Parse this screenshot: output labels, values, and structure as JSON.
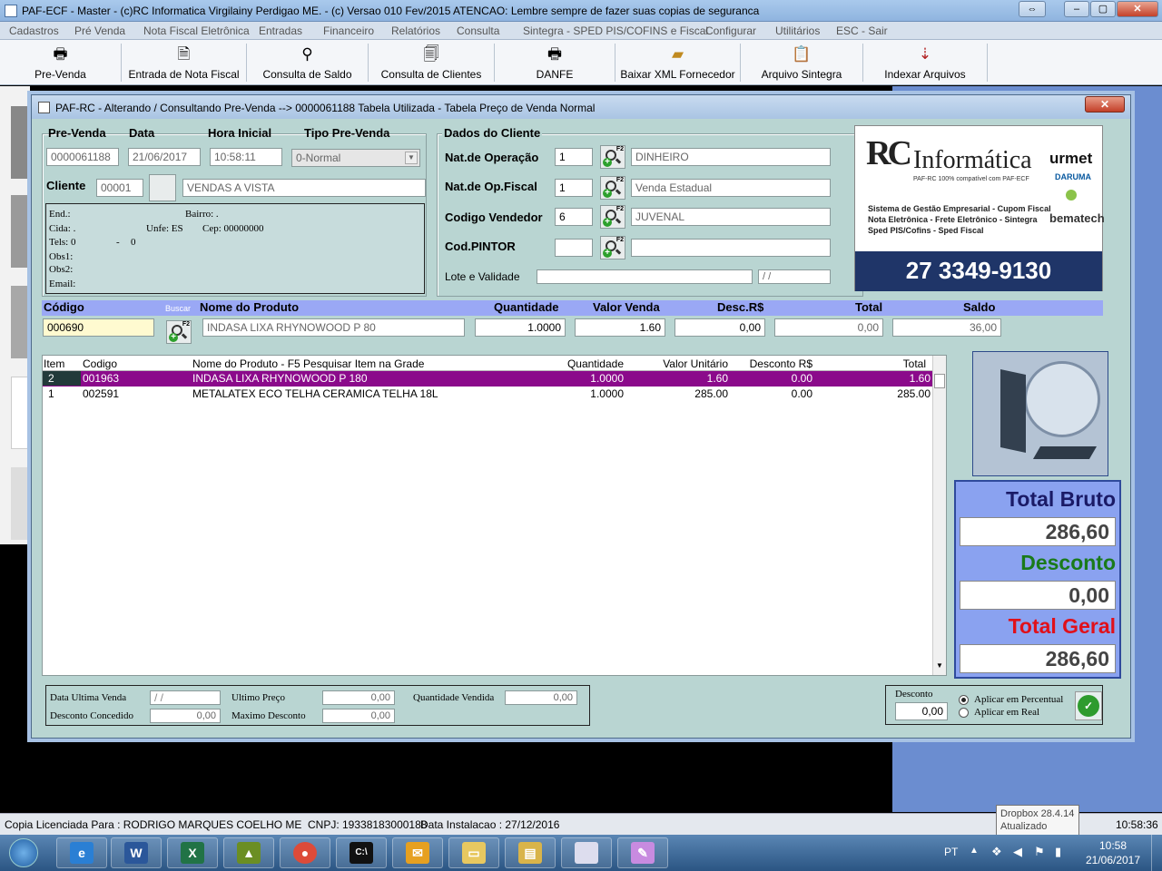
{
  "window": {
    "title": "PAF-ECF - Master - (c)RC Informatica Virgilainy Perdigao ME.  - (c) Versao 010 Fev/2015 ATENCAO: Lembre sempre de fazer suas copias de seguranca"
  },
  "menu": [
    "Cadastros",
    "Pré Venda",
    "Nota Fiscal Eletrônica",
    "Entradas",
    "Financeiro",
    "Relatórios",
    "Consulta",
    "Sintegra - SPED PIS/COFINS e Fiscal",
    "Configurar",
    "Utilitários",
    "ESC - Sair"
  ],
  "toolbar": [
    {
      "label": "Pre-Venda",
      "icon": "printer-icon"
    },
    {
      "label": "Entrada de Nota Fiscal",
      "icon": "document-icon"
    },
    {
      "label": "Consulta de Saldo",
      "icon": "magnifier-icon"
    },
    {
      "label": "Consulta de Clientes",
      "icon": "document-search-icon"
    },
    {
      "label": "DANFE",
      "icon": "printer-icon"
    },
    {
      "label": "Baixar XML Fornecedor",
      "icon": "folder-open-icon"
    },
    {
      "label": "Arquivo Sintegra",
      "icon": "clipboard-icon"
    },
    {
      "label": "Indexar Arquivos",
      "icon": "file-arrow-icon"
    }
  ],
  "dialog": {
    "title": "PAF-RC - Alterando / Consultando Pre-Venda --> 0000061188 Tabela Utilizada - Tabela Preço de Venda Normal",
    "prevenda": {
      "label_prevenda": "Pre-Venda",
      "label_data": "Data",
      "label_hora": "Hora Inicial",
      "label_tipo": "Tipo Pre-Venda",
      "numero": "0000061188",
      "data": "21/06/2017",
      "hora": "10:58:11",
      "tipo": "0-Normal",
      "label_cliente": "Cliente",
      "cliente_codigo": "00001",
      "cliente_nome": "VENDAS A VISTA"
    },
    "endereco": {
      "end": "End.:",
      "bairro": "Bairro: .",
      "cida": "Cida: .",
      "unfe": "Unfe: ES",
      "cep": "Cep: 00000000",
      "tels": "Tels: 0",
      "tels_dash": "-",
      "tels2": "0",
      "obs1": "Obs1:",
      "obs2": "Obs2:",
      "email": "Email:"
    },
    "cliente_dados": {
      "title": "Dados do Cliente",
      "nat_op_label": "Nat.de Operação",
      "nat_op_cod": "1",
      "nat_op_desc": "DINHEIRO",
      "nat_fiscal_label": "Nat.de Op.Fiscal",
      "nat_fiscal_cod": "1",
      "nat_fiscal_desc": "Venda Estadual",
      "vendedor_label": "Codigo Vendedor",
      "vendedor_cod": "6",
      "vendedor_desc": "JUVENAL",
      "pintor_label": "Cod.PINTOR",
      "pintor_cod": "",
      "pintor_desc": "",
      "lote_label": "Lote e Validade",
      "lote_value": "",
      "validade": " /  /"
    },
    "logo": {
      "brand": "Informática",
      "rc": "RC",
      "tagline": "PAF-RC 100% compatível com PAF-ECF",
      "line1": "Sistema de Gestão Empresarial  -  Cupom Fiscal",
      "line2": "Nota Eletrônica  -  Frete Eletrônico  -  Sintegra",
      "line3": "Sped PIS/Cofins  -  Sped Fiscal",
      "urmet": "urmet",
      "daruma": "DARUMA",
      "bematech": "bematech",
      "phone": "27 3349-9130"
    },
    "product_bar": {
      "codigo_label": "Código",
      "buscar": "Buscar",
      "nome_label": "Nome do Produto",
      "qtd_label": "Quantidade",
      "valor_label": "Valor Venda",
      "desc_label": "Desc.R$",
      "total_label": "Total",
      "saldo_label": "Saldo",
      "codigo": "000690",
      "nome": "INDASA LIXA RHYNOWOOD P 80",
      "quantidade": "1.0000",
      "valor": "1.60",
      "desconto": "0,00",
      "total": "0,00",
      "saldo": "36,00"
    },
    "grid": {
      "headers": [
        "Item",
        "Codigo",
        "Nome do Produto  -  F5 Pesquisar Item na Grade",
        "Quantidade",
        "Valor Unitário",
        "Desconto R$",
        "Total"
      ],
      "rows": [
        {
          "item": "2",
          "codigo": "001963",
          "nome": "INDASA LIXA RHYNOWOOD P 180",
          "qtd": "1.0000",
          "unit": "1.60",
          "desc": "0.00",
          "total": "1.60",
          "selected": true
        },
        {
          "item": "1",
          "codigo": "002591",
          "nome": "METALATEX ECO TELHA CERAMICA TELHA 18L",
          "qtd": "1.0000",
          "unit": "285.00",
          "desc": "0.00",
          "total": "285.00",
          "selected": false
        }
      ]
    },
    "totais": {
      "bruto_label": "Total Bruto",
      "bruto": "286,60",
      "desconto_label": "Desconto",
      "desconto": "0,00",
      "geral_label": "Total Geral",
      "geral": "286,60",
      "colors": {
        "bruto": "#1a1a66",
        "desconto": "#1a7a1a",
        "geral": "#e0101a"
      }
    },
    "footer": {
      "data_ult_label": "Data Ultima Venda",
      "data_ult": " /  /",
      "ult_preco_label": "Ultimo Preço",
      "ult_preco": "0,00",
      "qtd_vend_label": "Quantidade Vendida",
      "qtd_vend": "0,00",
      "desc_conc_label": "Desconto Concedido",
      "desc_conc": "0,00",
      "max_desc_label": "Maximo Desconto",
      "max_desc": "0,00",
      "desconto_label": "Desconto",
      "desconto": "0,00",
      "opt_percentual": "Aplicar em Percentual",
      "opt_real": "Aplicar em Real"
    }
  },
  "statusbar": {
    "licenca": "Copia Licenciada Para : RODRIGO MARQUES COELHO ME",
    "cnpj": "CNPJ: 19338183000188",
    "instalacao": "Data Instalacao : 27/12/2016",
    "time": "10:58:36"
  },
  "tooltip": {
    "line1": "Dropbox 28.4.14",
    "line2": "Atualizado"
  },
  "taskbar": {
    "lang": "PT",
    "clock_time": "10:58",
    "clock_date": "21/06/2017",
    "apps": [
      "internet-explorer",
      "word",
      "excel",
      "app-green",
      "chrome",
      "cmd",
      "outlook",
      "folder",
      "explorer",
      "app-window",
      "paint"
    ]
  }
}
